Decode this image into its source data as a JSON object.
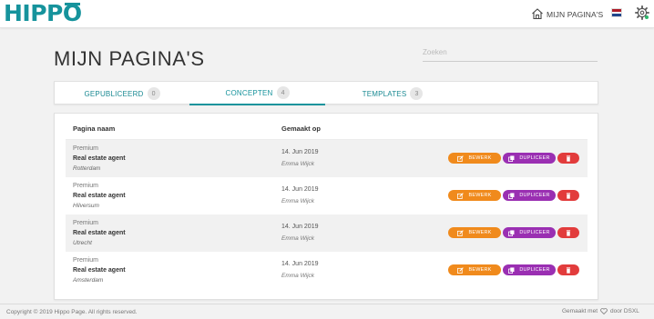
{
  "header": {
    "logo_text": "HIPPO",
    "nav_link": "MIJN PAGINA'S",
    "flag_colors": [
      "#ae1c28",
      "#ffffff",
      "#21468b"
    ],
    "status_color": "#2cb66a"
  },
  "page": {
    "title": "MIJN PAGINA'S",
    "search_placeholder": "Zoeken"
  },
  "tabs": [
    {
      "label": "GEPUBLICEERD",
      "count": "0",
      "active": false
    },
    {
      "label": "CONCEPTEN",
      "count": "4",
      "active": true
    },
    {
      "label": "TEMPLATES",
      "count": "3",
      "active": false
    }
  ],
  "table": {
    "columns": [
      "Pagina naam",
      "Gemaakt op"
    ],
    "rows": [
      {
        "tier": "Premium",
        "name": "Real estate agent",
        "location": "Rotterdam",
        "date": "14. Jun 2019",
        "author": "Emma Wijck"
      },
      {
        "tier": "Premium",
        "name": "Real estate agent",
        "location": "Hilversum",
        "date": "14. Jun 2019",
        "author": "Emma Wijck"
      },
      {
        "tier": "Premium",
        "name": "Real estate agent",
        "location": "Utrecht",
        "date": "14. Jun 2019",
        "author": "Emma Wijck"
      },
      {
        "tier": "Premium",
        "name": "Real estate agent",
        "location": "Amsterdam",
        "date": "14. Jun 2019",
        "author": "Emma Wijck"
      }
    ],
    "actions": {
      "edit": "BEWERK",
      "duplicate": "DUPLICEER",
      "edit_icon": "edit-icon",
      "duplicate_icon": "copy-icon",
      "delete_icon": "trash-icon"
    }
  },
  "colors": {
    "brand": "#16939c",
    "edit": "#f08a1c",
    "duplicate": "#9a2fb2",
    "delete": "#e23c3c"
  },
  "footer": {
    "copyright": "Copyright © 2019 Hippo Page. All rights reserved.",
    "made_prefix": "Gemaakt met",
    "made_suffix": "door DSXL"
  }
}
